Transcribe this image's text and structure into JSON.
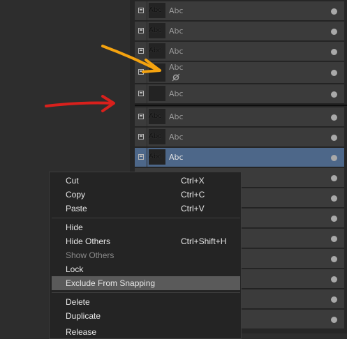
{
  "layers": {
    "rows": [
      {
        "name": "Abc",
        "thumb": "Abc",
        "selected": false
      },
      {
        "name": "Abc",
        "thumb": "Abc",
        "selected": false
      },
      {
        "name": "Abc",
        "thumb": "Abc",
        "selected": false
      },
      {
        "name": "Abc",
        "thumb": "",
        "selected": false,
        "excluded_snapping": true
      },
      {
        "name": "Abc",
        "thumb": "",
        "selected": false
      },
      {
        "name": "Abc",
        "thumb": "Abc",
        "selected": false
      },
      {
        "name": "Abc",
        "thumb": "Abc",
        "selected": false
      },
      {
        "name": "Abc",
        "thumb": "Abc",
        "selected": true
      }
    ]
  },
  "context_menu": {
    "items": [
      {
        "label": "Cut",
        "shortcut": "Ctrl+X"
      },
      {
        "label": "Copy",
        "shortcut": "Ctrl+C"
      },
      {
        "label": "Paste",
        "shortcut": "Ctrl+V"
      },
      {
        "label": "Hide",
        "shortcut": ""
      },
      {
        "label": "Hide Others",
        "shortcut": "Ctrl+Shift+H"
      },
      {
        "label": "Show Others",
        "shortcut": "",
        "disabled": true
      },
      {
        "label": "Lock",
        "shortcut": ""
      },
      {
        "label": "Exclude From Snapping",
        "shortcut": "",
        "hover": true
      },
      {
        "label": "Delete",
        "shortcut": ""
      },
      {
        "label": "Duplicate",
        "shortcut": ""
      },
      {
        "label": "Release",
        "shortcut": ""
      }
    ]
  },
  "annotations": {
    "arrow_colors": [
      "#f5a30f",
      "#d8201c"
    ]
  }
}
